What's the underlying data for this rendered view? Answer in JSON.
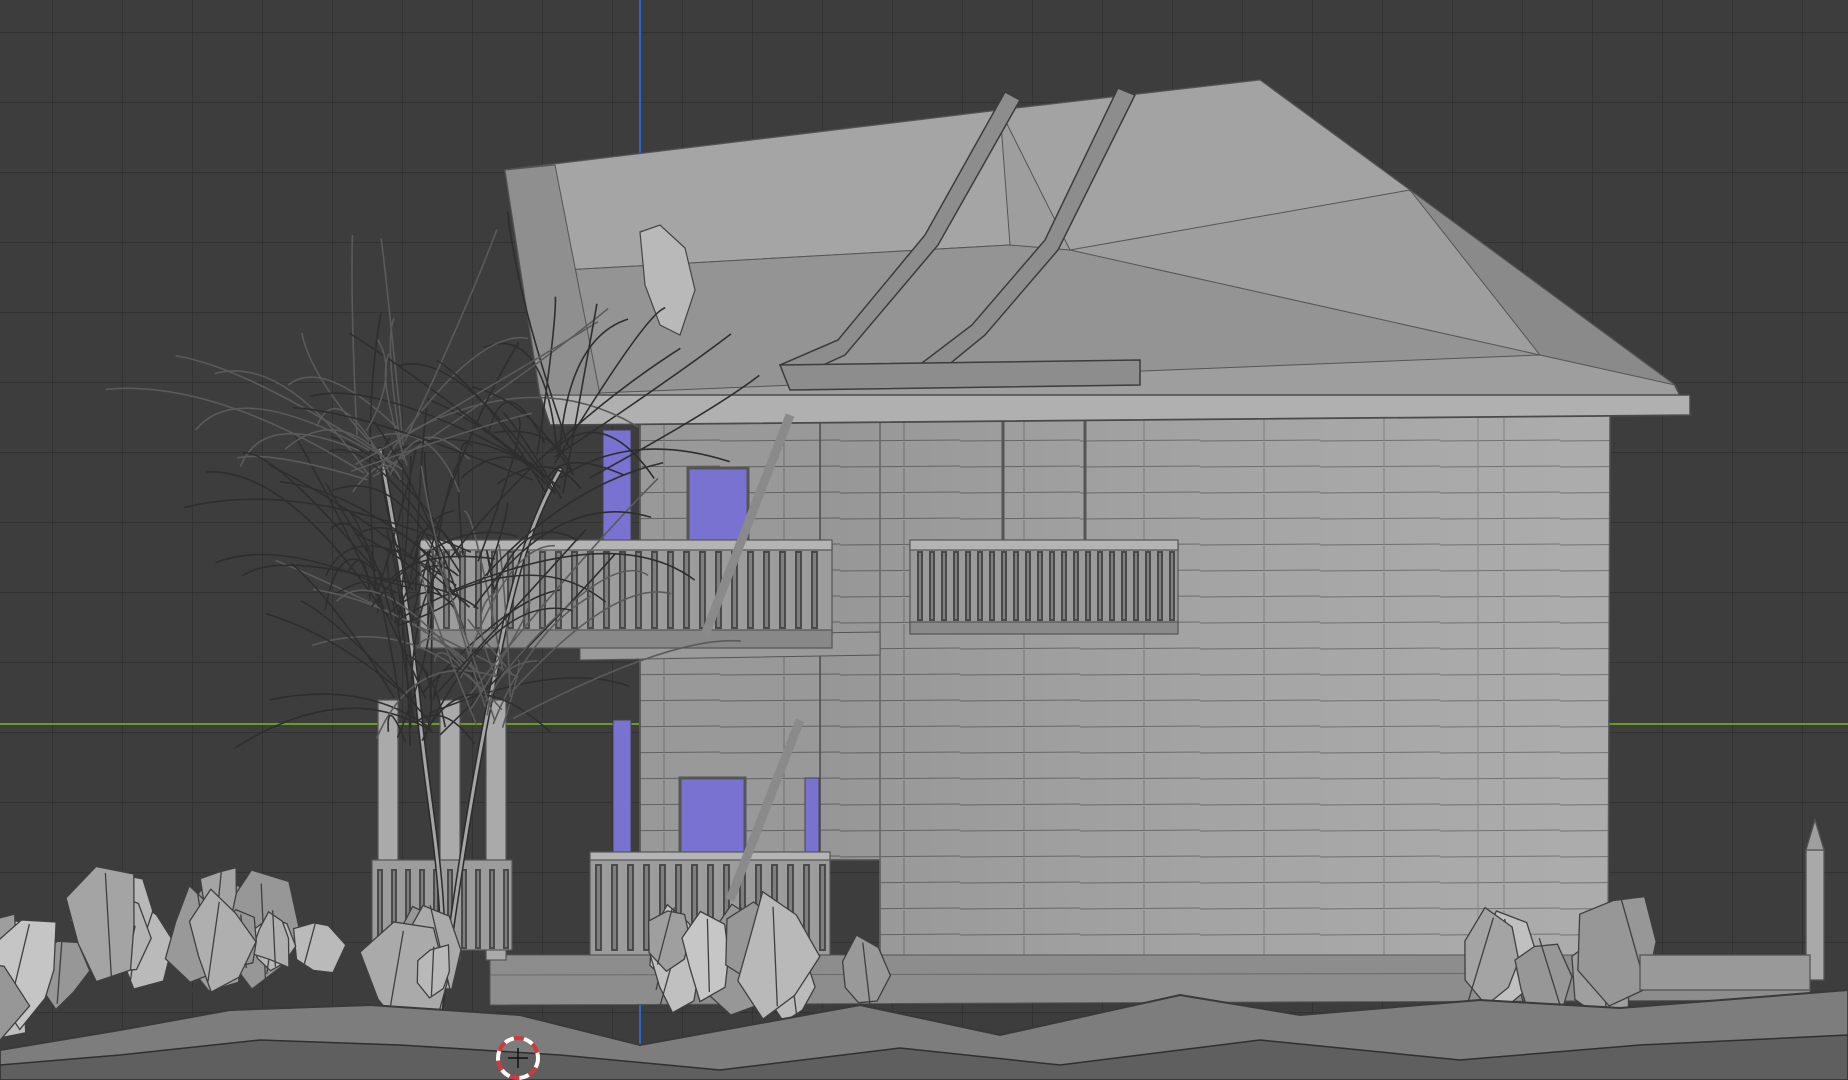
{
  "viewport": {
    "background": "#3d3d3d",
    "grid_color": "#2e2e2e",
    "x_axis_color": "#6e9a23",
    "y_axis_color": "#2f63c7",
    "mesh_color": "#a9a9a9",
    "wire_color": "#3a3a3a",
    "window_color": "#7a72d0",
    "cursor_colors": [
      "#d23a3a",
      "#ffffff"
    ]
  },
  "scene": {
    "objects": [
      "ground-terrain",
      "house-walls",
      "roof",
      "gable-trims",
      "balcony-upper-right",
      "balcony-upper-left",
      "porch-lower",
      "tree",
      "bushes",
      "fence-post"
    ],
    "icon": "3d-cursor-icon"
  }
}
